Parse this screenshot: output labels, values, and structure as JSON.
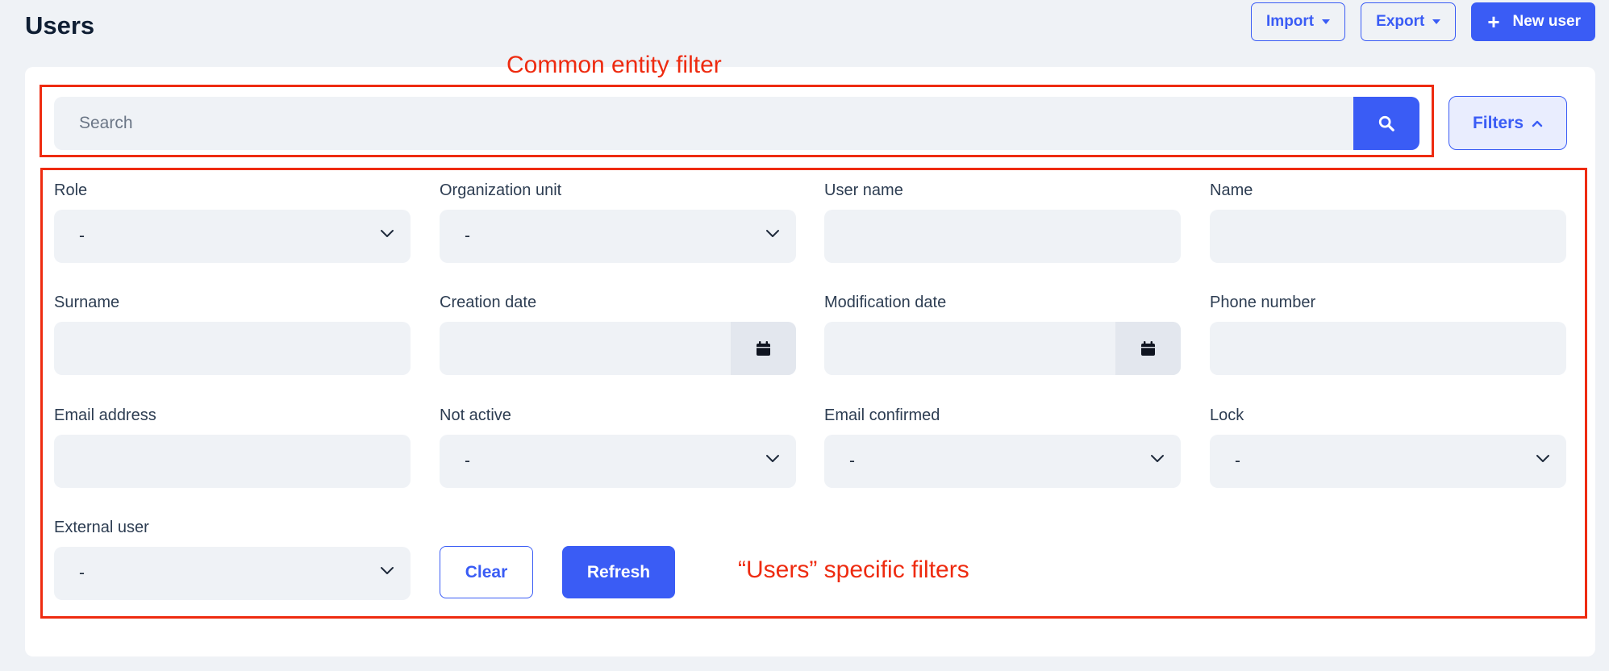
{
  "page": {
    "title": "Users"
  },
  "toolbar": {
    "import_label": "Import",
    "export_label": "Export",
    "new_user_label": "New user"
  },
  "search": {
    "placeholder": "Search"
  },
  "filters_button": {
    "label": "Filters"
  },
  "fields": {
    "role": {
      "label": "Role",
      "value": "-"
    },
    "organization_unit": {
      "label": "Organization unit",
      "value": "-"
    },
    "user_name": {
      "label": "User name",
      "value": ""
    },
    "name": {
      "label": "Name",
      "value": ""
    },
    "surname": {
      "label": "Surname",
      "value": ""
    },
    "creation_date": {
      "label": "Creation date",
      "value": ""
    },
    "modification_date": {
      "label": "Modification date",
      "value": ""
    },
    "phone_number": {
      "label": "Phone number",
      "value": ""
    },
    "email_address": {
      "label": "Email address",
      "value": ""
    },
    "not_active": {
      "label": "Not active",
      "value": "-"
    },
    "email_confirmed": {
      "label": "Email confirmed",
      "value": "-"
    },
    "lock": {
      "label": "Lock",
      "value": "-"
    },
    "external_user": {
      "label": "External user",
      "value": "-"
    }
  },
  "actions": {
    "clear_label": "Clear",
    "refresh_label": "Refresh"
  },
  "annotations": {
    "common_filter": "Common entity filter",
    "users_filters": "“Users” specific filters"
  },
  "colors": {
    "accent": "#3a5cf5",
    "annotation": "#ee2b10",
    "background": "#eff2f6"
  },
  "icons": {
    "search": "search-icon",
    "calendar": "calendar-icon",
    "chevron_down": "chevron-down-icon",
    "chevron_up": "chevron-up-icon",
    "plus": "plus-icon",
    "caret_down": "caret-down-icon"
  }
}
